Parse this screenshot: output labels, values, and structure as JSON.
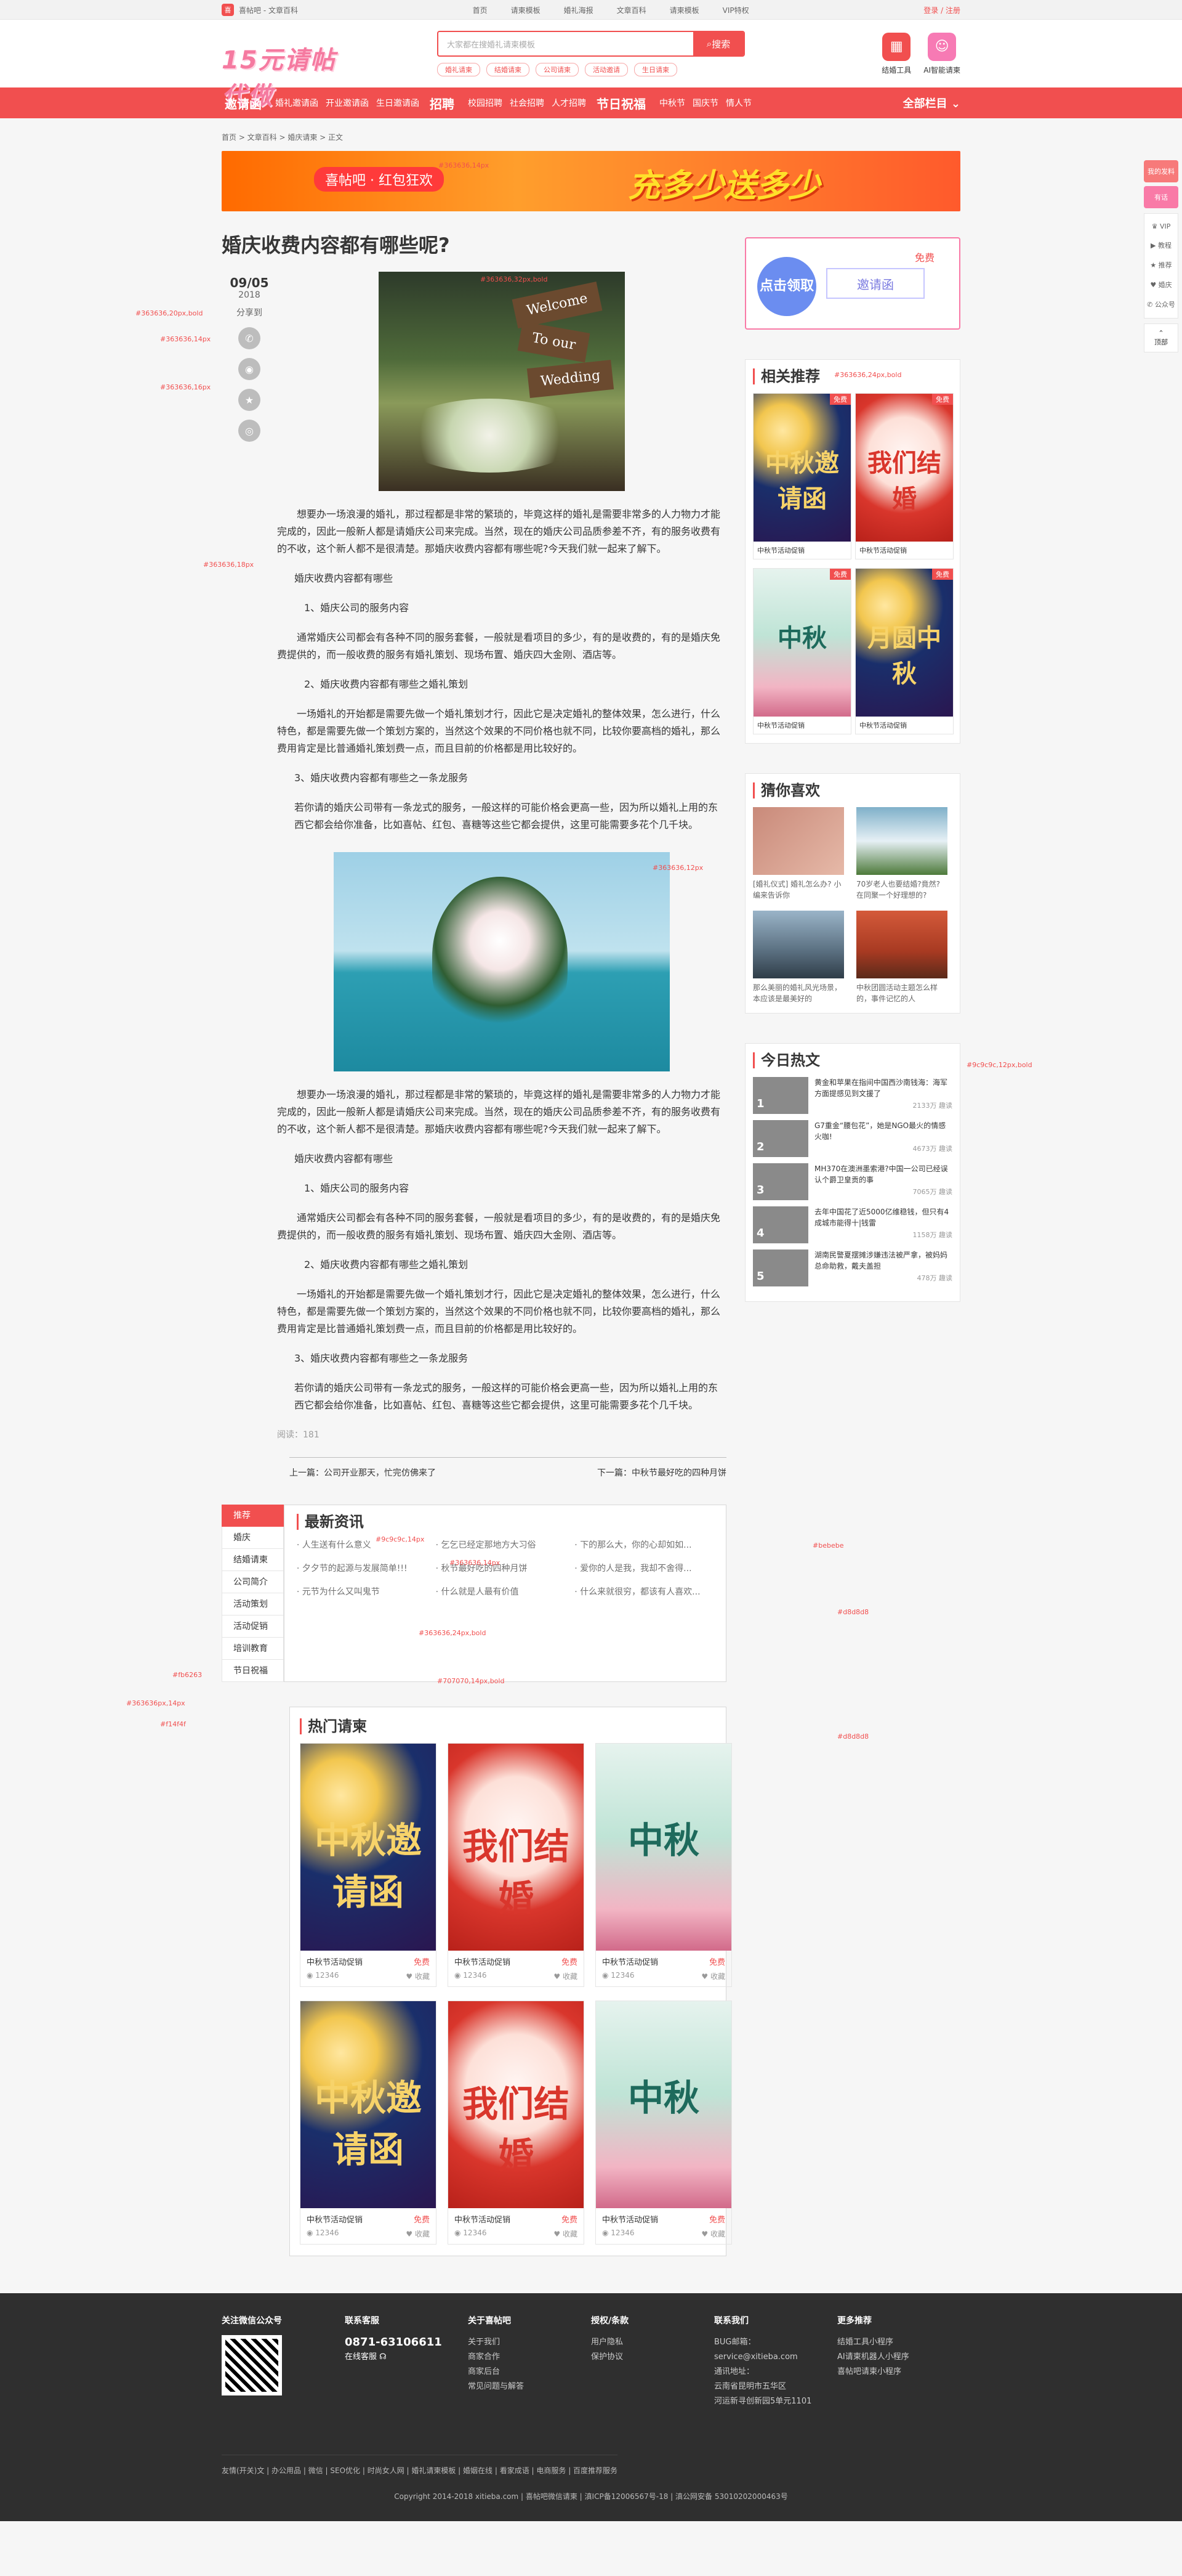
{
  "topbar": {
    "brand": "喜帖吧 - 文章百科",
    "links": [
      "首页",
      "请柬模板",
      "婚礼海报",
      "文章百科",
      "请柬模板",
      "VIP特权"
    ],
    "login": "登录 / 注册"
  },
  "header": {
    "logo_text": "15元请帖代做",
    "search_placeholder": "大家都在搜婚礼请柬模板",
    "search_button": "搜索",
    "tags": [
      "婚礼请柬",
      "结婚请柬",
      "公司请柬",
      "活动邀请",
      "生日请柬"
    ],
    "tools": [
      "结婚工具",
      "AI智能请柬"
    ]
  },
  "nav": {
    "groups": [
      {
        "big": "邀请函",
        "items": [
          "婚礼邀请函",
          "开业邀请函",
          "生日邀请函"
        ]
      },
      {
        "big": "招聘",
        "items": [
          "校园招聘",
          "社会招聘",
          "人才招聘"
        ]
      },
      {
        "big": "节日祝福",
        "items": [
          "中秋节",
          "国庆节",
          "情人节"
        ]
      }
    ],
    "all": "全部栏目"
  },
  "crumb": "首页 > 文章百科 > 婚庆请柬 > 正文",
  "banner": {
    "left": "喜帖吧 · 红包狂欢",
    "right": "充多少送多少"
  },
  "article": {
    "title": "婚庆收费内容都有哪些呢?",
    "share_label": "分享到",
    "date_day": "09/05",
    "date_year": "2018",
    "paragraphs": [
      "想要办一场浪漫的婚礼，那过程都是非常的繁琐的，毕竟这样的婚礼是需要非常多的人力物力才能完成的，因此一般新人都是请婚庆公司来完成。当然，现在的婚庆公司品质参差不齐，有的服务收费有的不收，这个新人都不是很清楚。那婚庆收费内容都有哪些呢?今天我们就一起来了解下。",
      "婚庆收费内容都有哪些",
      "1、婚庆公司的服务内容",
      "通常婚庆公司都会有各种不同的服务套餐，一般就是看项目的多少，有的是收费的，有的是婚庆免费提供的，而一般收费的服务有婚礼策划、现场布置、婚庆四大金刚、酒店等。",
      "2、婚庆收费内容都有哪些之婚礼策划",
      "一场婚礼的开始都是需要先做一个婚礼策划才行，因此它是决定婚礼的整体效果，怎么进行，什么特色，都是需要先做一个策划方案的，当然这个效果的不同价格也就不同，比较你要高档的婚礼，那么费用肯定是比普通婚礼策划费一点，而且目前的价格都是用比较好的。",
      "3、婚庆收费内容都有哪些之一条龙服务",
      "若你请的婚庆公司带有一条龙式的服务，一般这样的可能价格会更高一些，因为所以婚礼上用的东西它都会给你准备，比如喜帖、红包、喜糖等这些它都会提供，这里可能需要多花个几千块。"
    ],
    "paragraphs2": [
      "想要办一场浪漫的婚礼，那过程都是非常的繁琐的，毕竟这样的婚礼是需要非常多的人力物力才能完成的，因此一般新人都是请婚庆公司来完成。当然，现在的婚庆公司品质参差不齐，有的服务收费有的不收，这个新人都不是很清楚。那婚庆收费内容都有哪些呢?今天我们就一起来了解下。",
      "婚庆收费内容都有哪些",
      "1、婚庆公司的服务内容",
      "通常婚庆公司都会有各种不同的服务套餐，一般就是看项目的多少，有的是收费的，有的是婚庆免费提供的，而一般收费的服务有婚礼策划、现场布置、婚庆四大金刚、酒店等。",
      "2、婚庆收费内容都有哪些之婚礼策划",
      "一场婚礼的开始都是需要先做一个婚礼策划才行，因此它是决定婚礼的整体效果，怎么进行，什么特色，都是需要先做一个策划方案的，当然这个效果的不同价格也就不同，比较你要高档的婚礼，那么费用肯定是比普通婚礼策划费一点，而且目前的价格都是用比较好的。",
      "3、婚庆收费内容都有哪些之一条龙服务",
      "若你请的婚庆公司带有一条龙式的服务，一般这样的可能价格会更高一些，因为所以婚礼上用的东西它都会给你准备，比如喜帖、红包、喜糖等这些它都会提供，这里可能需要多花个几千块。"
    ],
    "image1_sign": [
      "Welcome",
      "To our",
      "Wedding"
    ],
    "read_count": "阅读：181"
  },
  "prevnext": {
    "prev": "上一篇：公司开业那天，忙完仿佛来了",
    "next": "下一篇：中秋节最好吃的四种月饼"
  },
  "latest": {
    "title": "最新资讯",
    "tabs": [
      "推荐",
      "婚庆",
      "结婚请柬",
      "公司简介",
      "活动策划",
      "活动促销",
      "培训教育",
      "节日祝福"
    ],
    "news": [
      "人生送有什么意义",
      "乞乞已经定那地方大习俗",
      "下的那么大，你的心却如如...",
      "夕夕节的起源与发展简单!!!",
      "秋节最好吃的四种月饼",
      "爱你的人是我，我却不舍得...",
      "元节为什么又叫鬼节",
      "什么就是人最有价值",
      "什么来就很穷，都该有人喜欢..."
    ]
  },
  "hot": {
    "title": "热门请柬",
    "cards": [
      {
        "art": "中秋邀请函",
        "name": "中秋节活动促销",
        "free": "免费",
        "views": "12346",
        "fav": "收藏"
      },
      {
        "art": "我们结婚",
        "name": "中秋节活动促销",
        "free": "免费",
        "views": "12346",
        "fav": "收藏"
      },
      {
        "art": "中秋",
        "name": "中秋节活动促销",
        "free": "免费",
        "views": "12346",
        "fav": "收藏"
      },
      {
        "art": "中秋邀请函",
        "name": "中秋节活动促销",
        "free": "免费",
        "views": "12346",
        "fav": "收藏"
      },
      {
        "art": "我们结婚",
        "name": "中秋节活动促销",
        "free": "免费",
        "views": "12346",
        "fav": "收藏"
      },
      {
        "art": "中秋",
        "name": "中秋节活动促销",
        "free": "免费",
        "views": "12346",
        "fav": "收藏"
      }
    ]
  },
  "right": {
    "ad": {
      "circle": "点击领取",
      "free": "免费",
      "inv": "邀请函"
    },
    "rec_title": "相关推荐",
    "recs": [
      {
        "art": "中秋邀请函",
        "tag": "免费",
        "name": "中秋节活动促销"
      },
      {
        "art": "我们结婚",
        "tag": "免费",
        "name": "中秋节活动促销"
      },
      {
        "art": "中秋",
        "tag": "免费",
        "name": "中秋节活动促销"
      },
      {
        "art": "月圆中秋",
        "tag": "免费",
        "name": "中秋节活动促销"
      }
    ],
    "guess_title": "猜你喜欢",
    "guess": [
      {
        "cap": "[婚礼仪式] 婚礼怎么办? 小编来告诉你"
      },
      {
        "cap": "70岁老人也要结婚?竟然? 在同聚一个好理想的?"
      },
      {
        "cap": "那么美丽的婚礼风光场景，本应该是最美好的"
      },
      {
        "cap": "中秋团圆活动主题怎么样的，事件记忆的人"
      }
    ],
    "hotlist_title": "今日热文",
    "hotlist": [
      {
        "n": "1",
        "tx": "黄金和苹果在指间中国西沙南钱海：海军方面提感见到文援了",
        "st": "2133万 趣读"
      },
      {
        "n": "2",
        "tx": "G7重金“腰包花”，她是NGO最火的情感火咖!",
        "st": "4673万 趣读"
      },
      {
        "n": "3",
        "tx": "MH370在澳洲墨索港?中国一公司已经误认个爵卫皇贡的事",
        "st": "7065万 趣读"
      },
      {
        "n": "4",
        "tx": "去年中国花了近5000亿维稳钱，但只有4成城市能得十|钱雷",
        "st": "1158万 趣读"
      },
      {
        "n": "5",
        "tx": "湖南民警夏摆摊涉嫌违法被严拿，被妈妈总命助救，戴夫盖担",
        "st": "478万 趣读"
      }
    ]
  },
  "float": {
    "red": "我的发料",
    "pink": "有话",
    "items": [
      "VIP",
      "教程",
      "推荐",
      "婚庆",
      "公众号"
    ],
    "top": "顶部"
  },
  "footer": {
    "cols": [
      {
        "h": "关注微信公众号",
        "items": []
      },
      {
        "h": "联系客服",
        "items": [
          "0871-63106611",
          "在线客服"
        ]
      },
      {
        "h": "关于喜帖吧",
        "items": [
          "关于我们",
          "商家合作",
          "商家后台",
          "常见问题与解答"
        ]
      },
      {
        "h": "授权/条款",
        "items": [
          "用户隐私",
          "保护协议"
        ]
      },
      {
        "h": "联系我们",
        "items": [
          "BUG邮箱：",
          "service@xitieba.com",
          "通讯地址：",
          "云南省昆明市五华区",
          "河运新寻创新园5单元1101"
        ]
      },
      {
        "h": "更多推荐",
        "items": [
          "结婚工具小程序",
          "AI请柬机器人小程序",
          "喜帖吧请柬小程序"
        ]
      }
    ],
    "bottom": "友情(开关)文 | 办公用品 | 微信 | SEO优化 | 时尚女人网 | 婚礼请柬模板 | 婚姻在线 | 看家成语 | 电商服务 | 百度推荐服务",
    "copy": "Copyright 2014-2018 xitieba.com | 喜帖吧微信请柬 | 滇ICP备12006567号-18 | 滇公网安备 53010202000463号"
  },
  "annotations": [
    "#363636,14px",
    "#363636,32px,bold",
    "#363636,20px,bold",
    "#363636,14px",
    "#363636,16px",
    "#363636,18px",
    "#bebebe",
    "#363636,24px,bold",
    "#363636,12px",
    "#9c9c9c,12px,bold",
    "#9c9c9c,14px",
    "#363636,14px",
    "#bebebe",
    "#d8d8d8",
    "#363636,24px,bold",
    "#707070,14px,bold",
    "#363636px,14px",
    "#d8d8d8",
    "#f14f4f",
    "#fb6263"
  ],
  "colors": {
    "accent": "#f14f4f",
    "pink": "#f97aa7",
    "text": "#363636",
    "muted": "#9c9c9c"
  }
}
